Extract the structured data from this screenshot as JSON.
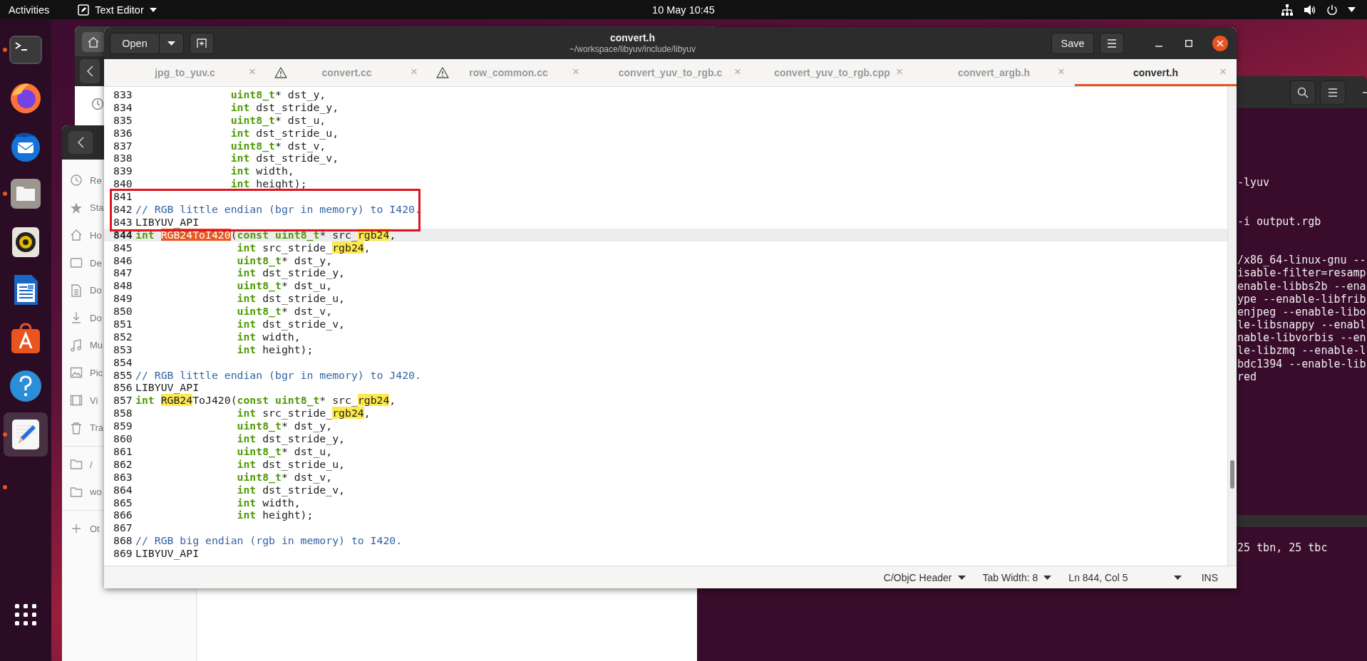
{
  "top_bar": {
    "activities": "Activities",
    "app_menu": "Text Editor",
    "clock": "10 May  10:45"
  },
  "dock": {
    "items": [
      {
        "kind": "terminal",
        "running": true,
        "selected": false
      },
      {
        "kind": "firefox",
        "running": false,
        "selected": false
      },
      {
        "kind": "thunderbird",
        "running": false,
        "selected": false
      },
      {
        "kind": "files",
        "running": true,
        "selected": false
      },
      {
        "kind": "rhythmbox",
        "running": false,
        "selected": false
      },
      {
        "kind": "writer",
        "running": false,
        "selected": false
      },
      {
        "kind": "software",
        "running": false,
        "selected": false
      },
      {
        "kind": "help",
        "running": false,
        "selected": false
      },
      {
        "kind": "text-editor",
        "running": true,
        "selected": true
      },
      {
        "kind": "indicator",
        "running": true
      },
      {
        "kind": "app-grid",
        "running": false,
        "selected": false
      }
    ]
  },
  "files_window": {
    "sidebar": [
      {
        "kind": "recent",
        "label": "Re"
      },
      {
        "kind": "starred",
        "label": "Sta"
      },
      {
        "kind": "home",
        "label": "Ho"
      },
      {
        "kind": "desktop",
        "label": "De"
      },
      {
        "kind": "documents",
        "label": "Do"
      },
      {
        "kind": "downloads",
        "label": "Do"
      },
      {
        "kind": "music",
        "label": "Mu"
      },
      {
        "kind": "pictures",
        "label": "Pic"
      },
      {
        "kind": "videos",
        "label": "Vi"
      },
      {
        "kind": "trash",
        "label": "Tra"
      },
      {
        "kind": "folder",
        "label": "/"
      },
      {
        "kind": "folder",
        "label": "wo"
      },
      {
        "kind": "other",
        "label": "Ot"
      }
    ]
  },
  "terminal": {
    "blocks": [
      [
        "-lyuv"
      ],
      [
        "-i output.rgb"
      ],
      [
        "/x86_64-linux-gnu --",
        "isable-filter=resamp",
        "enable-libbs2b --ena",
        "ype --enable-libfrib",
        "enjpeg --enable-libo",
        "le-libsnappy --enabl",
        "nable-libvorbis --en",
        "le-libzmq --enable-l",
        "bdc1394 --enable-lib",
        "red"
      ]
    ],
    "bottom_lines": [
      "25 tbn, 25 tbc"
    ]
  },
  "editor": {
    "open_button": "Open",
    "title": "convert.h",
    "path": "~/workspace/libyuv/include/libyuv",
    "save_button": "Save",
    "tabs": [
      {
        "label": "jpg_to_yuv.c",
        "warning": false,
        "selected": false,
        "close": "×"
      },
      {
        "label": "convert.cc",
        "warning": true,
        "selected": false,
        "close": "×"
      },
      {
        "label": "row_common.cc",
        "warning": true,
        "selected": false,
        "close": "×"
      },
      {
        "label": "convert_yuv_to_rgb.c",
        "warning": false,
        "selected": false,
        "close": "×"
      },
      {
        "label": "convert_yuv_to_rgb.cpp",
        "warning": false,
        "selected": false,
        "close": "×"
      },
      {
        "label": "convert_argb.h",
        "warning": false,
        "selected": false,
        "close": "×"
      },
      {
        "label": "convert.h",
        "warning": false,
        "selected": true,
        "close": "×"
      }
    ],
    "lines": [
      {
        "number": "833",
        "current": false,
        "boxed": false,
        "segments": [
          {
            "kind": "type",
            "text": "               uint8_t"
          },
          {
            "kind": "text",
            "text": "* dst_y,"
          }
        ]
      },
      {
        "number": "834",
        "current": false,
        "boxed": false,
        "segments": [
          {
            "kind": "type",
            "text": "               int"
          },
          {
            "kind": "text",
            "text": " dst_stride_y,"
          }
        ]
      },
      {
        "number": "835",
        "current": false,
        "boxed": false,
        "segments": [
          {
            "kind": "type",
            "text": "               uint8_t"
          },
          {
            "kind": "text",
            "text": "* dst_u,"
          }
        ]
      },
      {
        "number": "836",
        "current": false,
        "boxed": false,
        "segments": [
          {
            "kind": "type",
            "text": "               int"
          },
          {
            "kind": "text",
            "text": " dst_stride_u,"
          }
        ]
      },
      {
        "number": "837",
        "current": false,
        "boxed": false,
        "segments": [
          {
            "kind": "type",
            "text": "               uint8_t"
          },
          {
            "kind": "text",
            "text": "* dst_v,"
          }
        ]
      },
      {
        "number": "838",
        "current": false,
        "boxed": false,
        "segments": [
          {
            "kind": "type",
            "text": "               int"
          },
          {
            "kind": "text",
            "text": " dst_stride_v,"
          }
        ]
      },
      {
        "number": "839",
        "current": false,
        "boxed": false,
        "segments": [
          {
            "kind": "type",
            "text": "               int"
          },
          {
            "kind": "text",
            "text": " width,"
          }
        ]
      },
      {
        "number": "840",
        "current": false,
        "boxed": false,
        "segments": [
          {
            "kind": "type",
            "text": "               int"
          },
          {
            "kind": "text",
            "text": " height);"
          }
        ]
      },
      {
        "number": "841",
        "current": false,
        "boxed": true
      },
      {
        "number": "842",
        "current": false,
        "boxed": true,
        "segments": [
          {
            "kind": "comment",
            "text": "// RGB little endian (bgr in memory) to I420."
          }
        ]
      },
      {
        "number": "843",
        "current": false,
        "boxed": true,
        "segments": [
          {
            "kind": "text",
            "text": "LIBYUV_API"
          }
        ]
      },
      {
        "number": "844",
        "current": true,
        "boxed": false,
        "segments": [
          {
            "kind": "type",
            "text": "int "
          },
          {
            "kind": "current-match",
            "text": "RGB24ToI420"
          },
          {
            "kind": "text",
            "text": "("
          },
          {
            "kind": "type",
            "text": "const uint8_t"
          },
          {
            "kind": "text",
            "text": "* src_"
          },
          {
            "kind": "match",
            "text": "rgb24"
          },
          {
            "kind": "text",
            "text": ","
          }
        ]
      },
      {
        "number": "845",
        "current": false,
        "boxed": false,
        "segments": [
          {
            "kind": "type",
            "text": "                int"
          },
          {
            "kind": "text",
            "text": " src_stride_"
          },
          {
            "kind": "match",
            "text": "rgb24"
          },
          {
            "kind": "text",
            "text": ","
          }
        ]
      },
      {
        "number": "846",
        "current": false,
        "boxed": false,
        "segments": [
          {
            "kind": "type",
            "text": "                uint8_t"
          },
          {
            "kind": "text",
            "text": "* dst_y,"
          }
        ]
      },
      {
        "number": "847",
        "current": false,
        "boxed": false,
        "segments": [
          {
            "kind": "type",
            "text": "                int"
          },
          {
            "kind": "text",
            "text": " dst_stride_y,"
          }
        ]
      },
      {
        "number": "848",
        "current": false,
        "boxed": false,
        "segments": [
          {
            "kind": "type",
            "text": "                uint8_t"
          },
          {
            "kind": "text",
            "text": "* dst_u,"
          }
        ]
      },
      {
        "number": "849",
        "current": false,
        "boxed": false,
        "segments": [
          {
            "kind": "type",
            "text": "                int"
          },
          {
            "kind": "text",
            "text": " dst_stride_u,"
          }
        ]
      },
      {
        "number": "850",
        "current": false,
        "boxed": false,
        "segments": [
          {
            "kind": "type",
            "text": "                uint8_t"
          },
          {
            "kind": "text",
            "text": "* dst_v,"
          }
        ]
      },
      {
        "number": "851",
        "current": false,
        "boxed": false,
        "segments": [
          {
            "kind": "type",
            "text": "                int"
          },
          {
            "kind": "text",
            "text": " dst_stride_v,"
          }
        ]
      },
      {
        "number": "852",
        "current": false,
        "boxed": false,
        "segments": [
          {
            "kind": "type",
            "text": "                int"
          },
          {
            "kind": "text",
            "text": " width,"
          }
        ]
      },
      {
        "number": "853",
        "current": false,
        "boxed": false,
        "segments": [
          {
            "kind": "type",
            "text": "                int"
          },
          {
            "kind": "text",
            "text": " height);"
          }
        ]
      },
      {
        "number": "854",
        "current": false,
        "boxed": false
      },
      {
        "number": "855",
        "current": false,
        "boxed": false,
        "segments": [
          {
            "kind": "comment",
            "text": "// RGB little endian (bgr in memory) to J420."
          }
        ]
      },
      {
        "number": "856",
        "current": false,
        "boxed": false,
        "segments": [
          {
            "kind": "text",
            "text": "LIBYUV_API"
          }
        ]
      },
      {
        "number": "857",
        "current": false,
        "boxed": false,
        "segments": [
          {
            "kind": "type",
            "text": "int "
          },
          {
            "kind": "match",
            "text": "RGB24"
          },
          {
            "kind": "text",
            "text": "ToJ420("
          },
          {
            "kind": "type",
            "text": "const uint8_t"
          },
          {
            "kind": "text",
            "text": "* src_"
          },
          {
            "kind": "match",
            "text": "rgb24"
          },
          {
            "kind": "text",
            "text": ","
          }
        ]
      },
      {
        "number": "858",
        "current": false,
        "boxed": false,
        "segments": [
          {
            "kind": "type",
            "text": "                int"
          },
          {
            "kind": "text",
            "text": " src_stride_"
          },
          {
            "kind": "match",
            "text": "rgb24"
          },
          {
            "kind": "text",
            "text": ","
          }
        ]
      },
      {
        "number": "859",
        "current": false,
        "boxed": false,
        "segments": [
          {
            "kind": "type",
            "text": "                uint8_t"
          },
          {
            "kind": "text",
            "text": "* dst_y,"
          }
        ]
      },
      {
        "number": "860",
        "current": false,
        "boxed": false,
        "segments": [
          {
            "kind": "type",
            "text": "                int"
          },
          {
            "kind": "text",
            "text": " dst_stride_y,"
          }
        ]
      },
      {
        "number": "861",
        "current": false,
        "boxed": false,
        "segments": [
          {
            "kind": "type",
            "text": "                uint8_t"
          },
          {
            "kind": "text",
            "text": "* dst_u,"
          }
        ]
      },
      {
        "number": "862",
        "current": false,
        "boxed": false,
        "segments": [
          {
            "kind": "type",
            "text": "                int"
          },
          {
            "kind": "text",
            "text": " dst_stride_u,"
          }
        ]
      },
      {
        "number": "863",
        "current": false,
        "boxed": false,
        "segments": [
          {
            "kind": "type",
            "text": "                uint8_t"
          },
          {
            "kind": "text",
            "text": "* dst_v,"
          }
        ]
      },
      {
        "number": "864",
        "current": false,
        "boxed": false,
        "segments": [
          {
            "kind": "type",
            "text": "                int"
          },
          {
            "kind": "text",
            "text": " dst_stride_v,"
          }
        ]
      },
      {
        "number": "865",
        "current": false,
        "boxed": false,
        "segments": [
          {
            "kind": "type",
            "text": "                int"
          },
          {
            "kind": "text",
            "text": " width,"
          }
        ]
      },
      {
        "number": "866",
        "current": false,
        "boxed": false,
        "segments": [
          {
            "kind": "type",
            "text": "                int"
          },
          {
            "kind": "text",
            "text": " height);"
          }
        ]
      },
      {
        "number": "867",
        "current": false,
        "boxed": false
      },
      {
        "number": "868",
        "current": false,
        "boxed": false,
        "segments": [
          {
            "kind": "comment",
            "text": "// RGB big endian (rgb in memory) to I420."
          }
        ]
      },
      {
        "number": "869",
        "current": false,
        "boxed": false,
        "segments": [
          {
            "kind": "text",
            "text": "LIBYUV_API"
          }
        ]
      }
    ],
    "status_bar": [
      {
        "kind": "dropdown",
        "text": "C/ObjC Header"
      },
      {
        "kind": "dropdown",
        "text": "Tab Width: 8"
      },
      {
        "kind": "label",
        "text": "Ln 844, Col 5"
      },
      {
        "kind": "menu-caret"
      },
      {
        "kind": "label",
        "text": "INS"
      }
    ]
  }
}
